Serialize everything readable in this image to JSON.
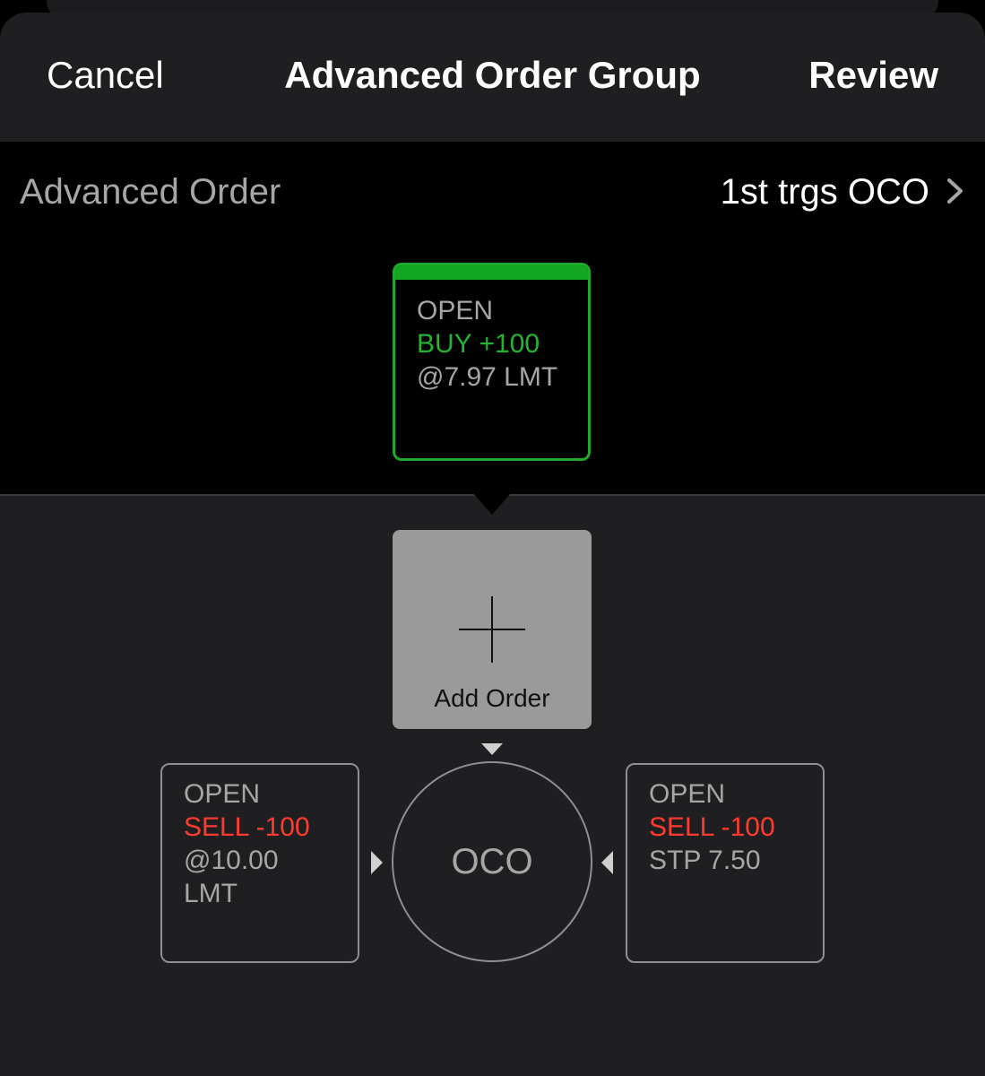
{
  "header": {
    "cancel_label": "Cancel",
    "title": "Advanced Order Group",
    "review_label": "Review"
  },
  "advanced_order": {
    "label": "Advanced Order",
    "value": "1st trgs OCO"
  },
  "primary_order": {
    "status": "OPEN",
    "action": "BUY +100",
    "detail": "@7.97 LMT",
    "accent_color": "#12a622"
  },
  "add_order": {
    "label": "Add Order"
  },
  "oco": {
    "label": "OCO",
    "left_order": {
      "status": "OPEN",
      "action": "SELL -100",
      "detail_line1": "@10.00",
      "detail_line2": "LMT"
    },
    "right_order": {
      "status": "OPEN",
      "action": "SELL -100",
      "detail_line1": "STP 7.50"
    }
  },
  "colors": {
    "buy": "#22b52f",
    "sell": "#ff3b30",
    "muted_text": "#a6a6a6"
  }
}
